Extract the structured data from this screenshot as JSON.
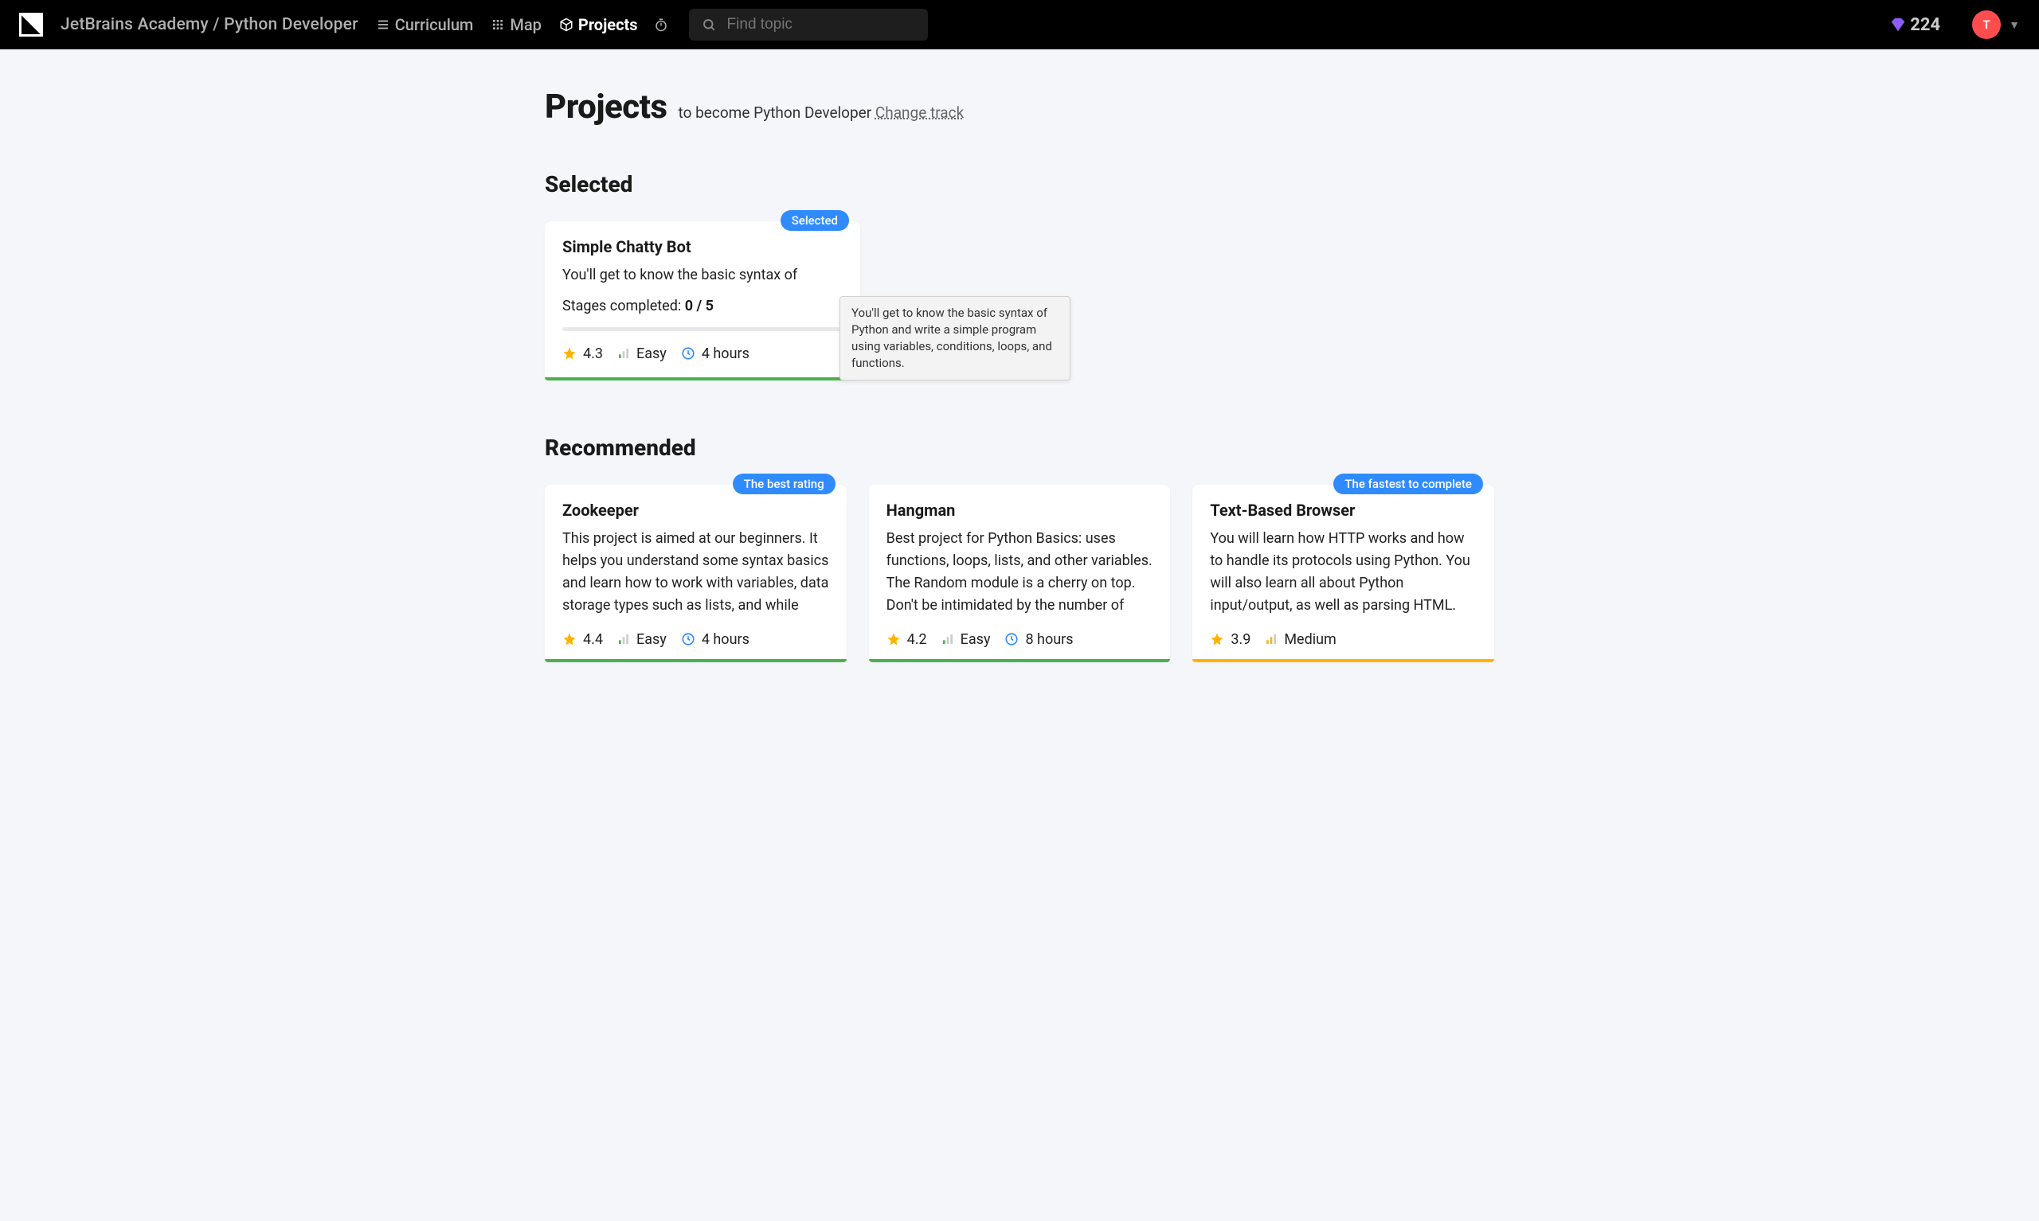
{
  "header": {
    "breadcrumb": "JetBrains Academy / Python Developer",
    "nav": {
      "curriculum": "Curriculum",
      "map": "Map",
      "projects": "Projects"
    },
    "search_placeholder": "Find topic",
    "gem_count": "224",
    "avatar_initial": "T"
  },
  "page": {
    "title": "Projects",
    "subtitle": "to become Python Developer",
    "change_track": "Change track"
  },
  "tooltip": "You'll get to know the basic syntax of Python and write a simple program using variables, conditions, loops, and functions.",
  "sections": {
    "selected": {
      "heading": "Selected",
      "card": {
        "badge": "Selected",
        "title": "Simple Chatty Bot",
        "description": "You'll get to know the basic syntax of",
        "stages_label": "Stages completed:",
        "stages_value": "0 / 5",
        "rating": "4.3",
        "difficulty": "Easy",
        "time": "4 hours"
      }
    },
    "recommended": {
      "heading": "Recommended",
      "cards": [
        {
          "badge": "The best rating",
          "title": "Zookeeper",
          "description": "This project is aimed at our beginners. It helps you understand some syntax basics and learn how to work with variables, data storage types such as lists, and while",
          "rating": "4.4",
          "difficulty": "Easy",
          "time": "4 hours"
        },
        {
          "badge": "",
          "title": "Hangman",
          "description": "Best project for Python Basics: uses functions, loops, lists, and other variables. The Random module is a cherry on top. Don't be intimidated by the number of",
          "rating": "4.2",
          "difficulty": "Easy",
          "time": "8 hours"
        },
        {
          "badge": "The fastest to complete",
          "title": "Text-Based Browser",
          "description": "You will learn how HTTP works and how to handle its protocols using Python. You will also learn all about Python input/output, as well as parsing HTML.",
          "rating": "3.9",
          "difficulty": "Medium",
          "time": ""
        }
      ]
    }
  }
}
